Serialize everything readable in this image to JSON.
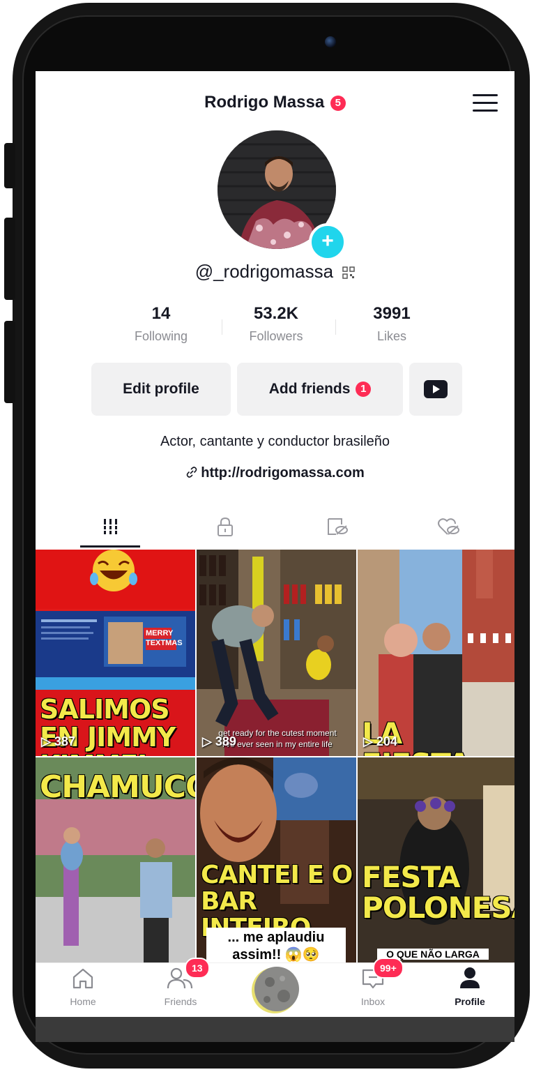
{
  "header": {
    "name": "Rodrigo Massa",
    "name_badge": "5"
  },
  "profile": {
    "handle": "@_rodrigomassa",
    "stats": [
      {
        "value": "14",
        "label": "Following"
      },
      {
        "value": "53.2K",
        "label": "Followers"
      },
      {
        "value": "3991",
        "label": "Likes"
      }
    ],
    "edit_label": "Edit profile",
    "add_friends_label": "Add friends",
    "add_friends_badge": "1",
    "bio": "Actor, cantante y conductor brasileño",
    "link": "http://rodrigomassa.com"
  },
  "tabs": [
    "videos-grid-icon",
    "private-lock-icon",
    "reposts-icon",
    "liked-icon"
  ],
  "videos": [
    {
      "title": "SALIMOS EN JIMMY KIMMEL",
      "views": "387",
      "banner": "MERRY TEXTMAS"
    },
    {
      "title": "",
      "views": "389",
      "caption": "get ready for the cutest moment i've ever seen in my entire life"
    },
    {
      "title": "LA FIESTA",
      "views": "204"
    },
    {
      "title": "CHAMUCO",
      "views": ""
    },
    {
      "title": "CANTEI E O BAR INTEIRO...",
      "views": "",
      "caption": "... me aplaudiu assim!! 😱🥺"
    },
    {
      "title": "FESTA POLONESA",
      "views": "",
      "caption": "O QUE NÃO LARGA"
    }
  ],
  "nav": {
    "home": "Home",
    "friends": "Friends",
    "friends_badge": "13",
    "inbox": "Inbox",
    "inbox_badge": "99+",
    "profile": "Profile"
  },
  "colors": {
    "accent": "#fe2c55",
    "plus": "#20d5ec",
    "caption_yellow": "#f3e94a"
  }
}
